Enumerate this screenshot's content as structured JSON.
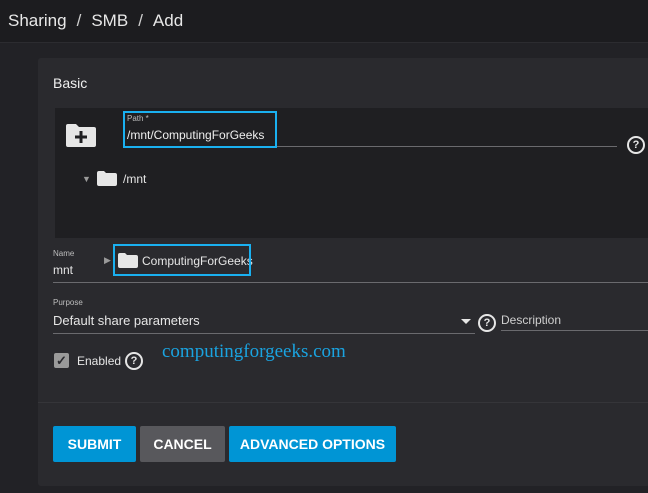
{
  "breadcrumb": {
    "items": [
      "Sharing",
      "SMB",
      "Add"
    ],
    "separator": "/"
  },
  "form": {
    "section_title": "Basic",
    "path": {
      "label": "Path *",
      "value": "/mnt/ComputingForGeeks"
    },
    "tree": {
      "root": "/mnt",
      "child": "ComputingForGeeks"
    },
    "name": {
      "label": "Name",
      "value": "mnt"
    },
    "purpose": {
      "label": "Purpose",
      "value": "Default share parameters"
    },
    "description": {
      "placeholder": "Description"
    },
    "enabled": {
      "label": "Enabled",
      "checked": true
    },
    "help_glyph": "?"
  },
  "watermark": "computingforgeeks.com",
  "buttons": {
    "submit": "SUBMIT",
    "cancel": "CANCEL",
    "advanced": "ADVANCED OPTIONS"
  },
  "colors": {
    "accent": "#0095d5",
    "highlight": "#1ab0f0",
    "cancel": "#58585c"
  },
  "icons": [
    "folder-add-icon",
    "help-icon",
    "folder-icon",
    "tree-expand-icon",
    "checkmark-icon",
    "dropdown-caret-icon"
  ]
}
